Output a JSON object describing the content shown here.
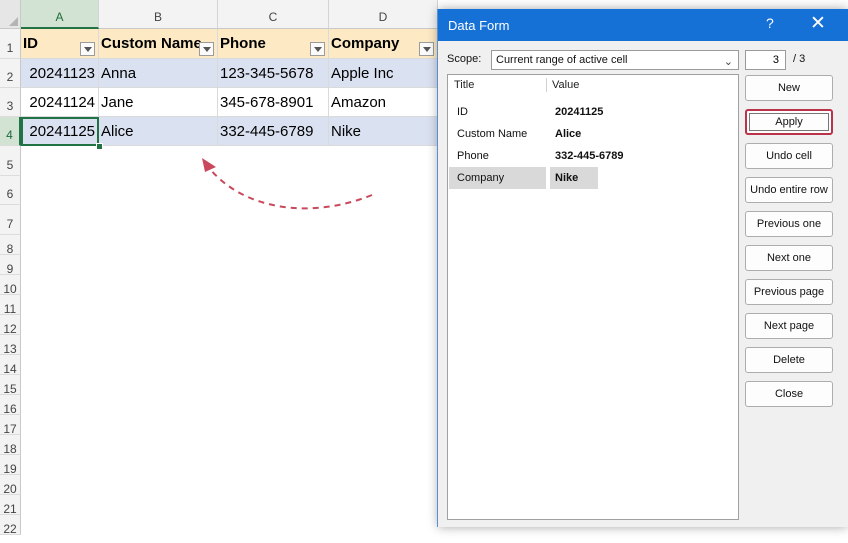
{
  "sheet": {
    "columns": [
      "A",
      "B",
      "C",
      "D"
    ],
    "rows": [
      "1",
      "2",
      "3",
      "4",
      "5",
      "6",
      "7",
      "8",
      "9",
      "10",
      "11",
      "12",
      "13",
      "14",
      "15",
      "16",
      "17",
      "18",
      "19",
      "20",
      "21",
      "22"
    ],
    "header": [
      "ID",
      "Custom Name",
      "Phone",
      "Company"
    ],
    "data": [
      [
        "20241123",
        "Anna",
        "123-345-5678",
        "Apple Inc"
      ],
      [
        "20241124",
        "Jane",
        "345-678-8901",
        "Amazon"
      ],
      [
        "20241125",
        "Alice",
        "332-445-6789",
        "Nike"
      ]
    ]
  },
  "dialog": {
    "title": "Data Form",
    "help": "?",
    "close": "✕",
    "scope_label": "Scope:",
    "scope_value": "Current range of active cell",
    "scope_chevron": "⌄",
    "page_current": "3",
    "page_total": "/  3",
    "list_header": {
      "title": "Title",
      "value": "Value"
    },
    "fields": [
      {
        "title": "ID",
        "value": "20241125"
      },
      {
        "title": "Custom Name",
        "value": "Alice"
      },
      {
        "title": "Phone",
        "value": "332-445-6789"
      },
      {
        "title": "Company",
        "value": "Nike"
      }
    ],
    "buttons": [
      "New",
      "Apply",
      "Undo cell",
      "Undo entire row",
      "Previous one",
      "Next one",
      "Previous page",
      "Next page",
      "Delete",
      "Close"
    ]
  },
  "colors": {
    "header_fill": "#fde9c4",
    "band_fill": "#dae1f0",
    "titlebar": "#1671d7",
    "arrow": "#c9485b",
    "selection": "#217346"
  }
}
